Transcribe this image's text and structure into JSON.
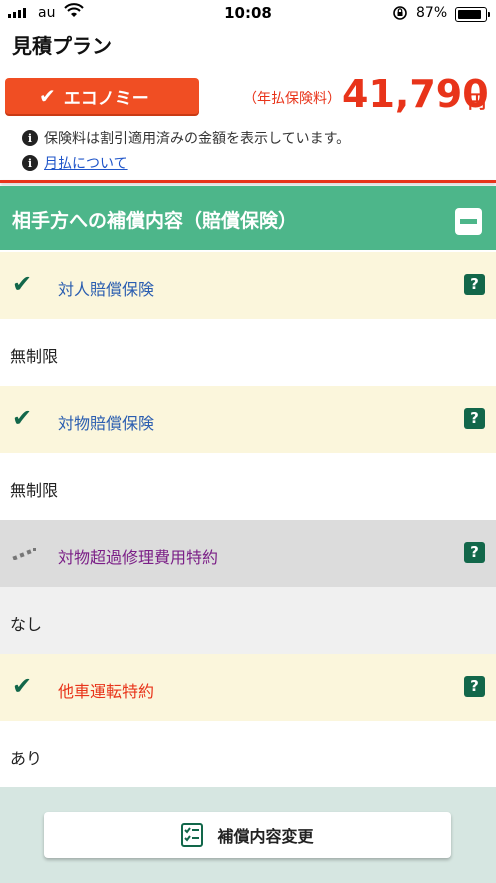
{
  "status_bar": {
    "carrier": "au",
    "time": "10:08",
    "battery": "87%",
    "battery_level": 0.87
  },
  "plan": {
    "title": "見積プラン",
    "name": "エコノミー",
    "price_label": "（年払保険料）",
    "price": "41,790",
    "price_unit": "円",
    "note1": "保険料は割引適用済みの金額を表示しています。",
    "note2_link": "月払について",
    "info_icon_glyph": "i"
  },
  "section": {
    "title": "相手方への補償内容（賠償保険）"
  },
  "coverages": [
    {
      "label": "対人賠償保険",
      "value": "無制限",
      "status": "included",
      "label_color": "#2a5db0",
      "head_bg": "#fbf6dc",
      "val_bg": "#ffffff"
    },
    {
      "label": "対物賠償保険",
      "value": "無制限",
      "status": "included",
      "label_color": "#2a5db0",
      "head_bg": "#fbf6dc",
      "val_bg": "#ffffff"
    },
    {
      "label": "対物超過修理費用特約",
      "value": "なし",
      "status": "not-included",
      "label_color": "#7b1f87",
      "head_bg": "#dcdcdc",
      "val_bg": "#f0f0f0"
    },
    {
      "label": "他車運転特約",
      "value": "あり",
      "status": "included",
      "label_color": "#e8341a",
      "head_bg": "#fbf6dc",
      "val_bg": "#ffffff"
    }
  ],
  "help_glyph": "?",
  "check_glyph": "✔",
  "cta": {
    "label": "補償内容変更"
  },
  "colors": {
    "accent_orange": "#f04e23",
    "price_red": "#e8341a",
    "section_green": "#4db68a",
    "dark_green": "#12674a",
    "footer_bg": "#d6e6e1"
  }
}
